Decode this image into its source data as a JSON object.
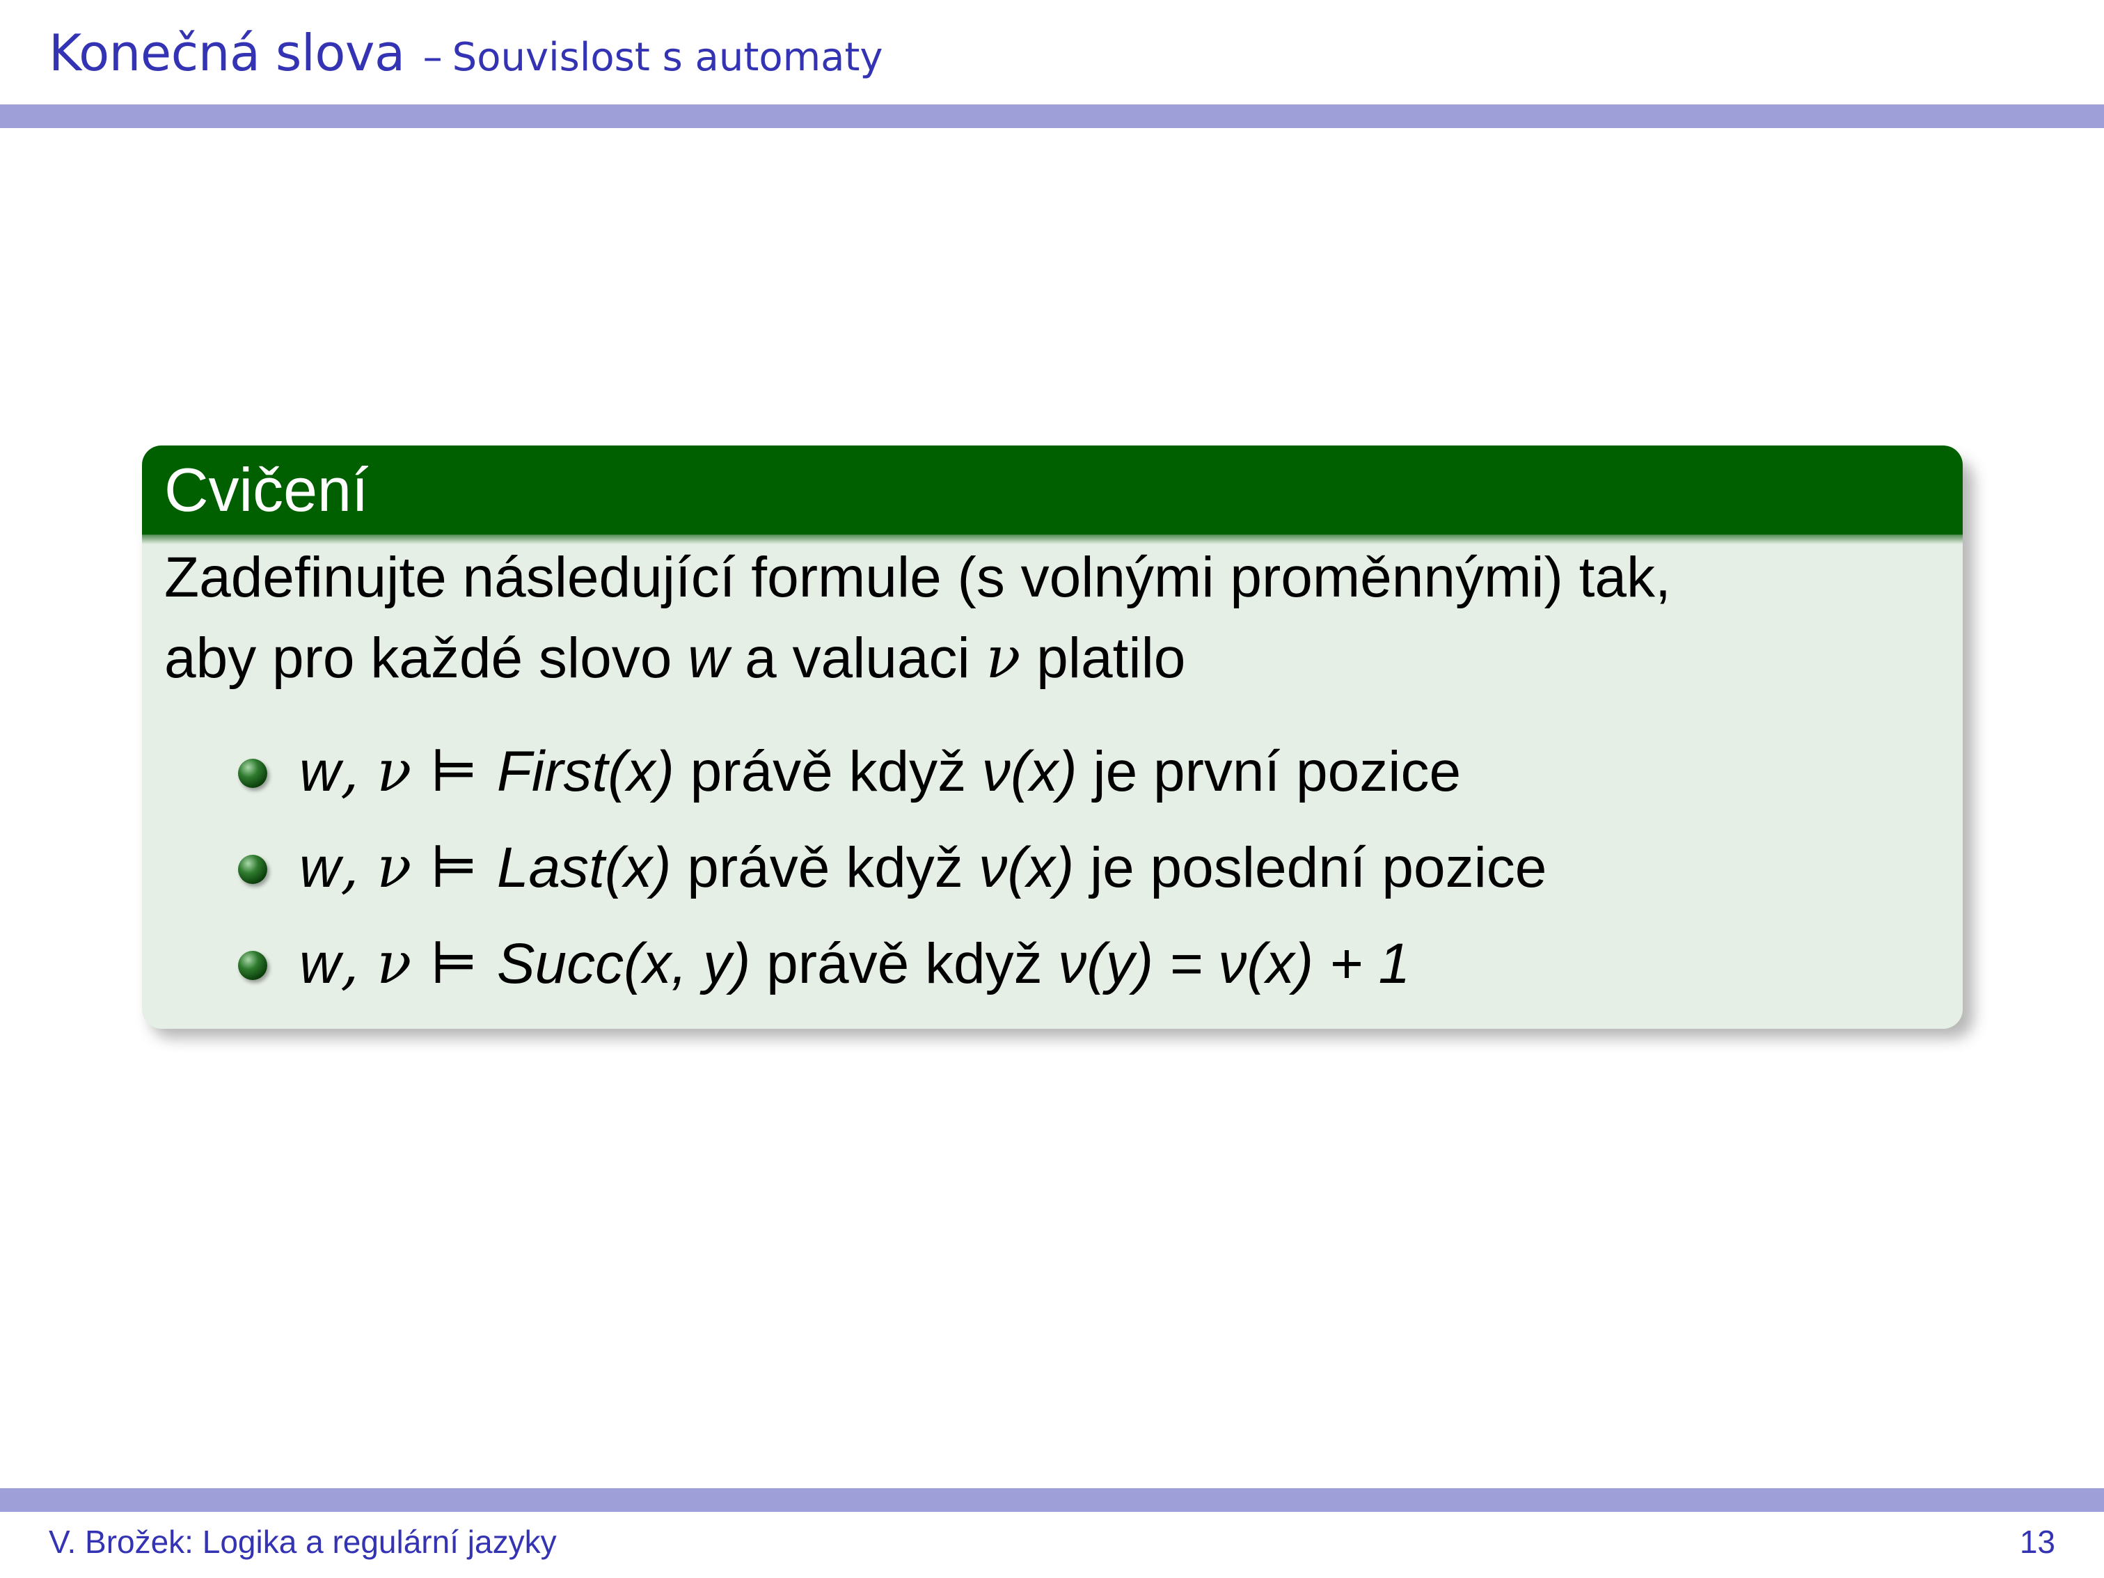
{
  "header": {
    "title": "Konečná slova",
    "separator": "–",
    "subtitle": "Souvislost s automaty"
  },
  "block": {
    "title": "Cvičení",
    "intro_line1": "Zadefinujte následující formule (s volnými proměnnými) tak,",
    "intro_line2_a": "aby pro každé slovo ",
    "intro_line2_w": "w",
    "intro_line2_b": " a valuaci ",
    "intro_line2_nu": "ν",
    "intro_line2_c": " platilo",
    "items": [
      {
        "w": "w",
        "comma_nu": ", ν",
        "models": " ⊨ ",
        "formula": "First",
        "args": "(x)",
        "text": " právě když ",
        "cond": "ν(x)",
        "rest": " je první pozice"
      },
      {
        "w": "w",
        "comma_nu": ", ν",
        "models": " ⊨ ",
        "formula": "Last",
        "args": "(x)",
        "text": " právě když ",
        "cond": "ν(x)",
        "rest": " je poslední pozice"
      },
      {
        "w": "w",
        "comma_nu": ", ν",
        "models": " ⊨ ",
        "formula": "Succ",
        "args": "(x, y)",
        "text": " právě když ",
        "cond": "ν(y) = ν(x) + 1",
        "rest": ""
      }
    ]
  },
  "footer": {
    "left": "V. Brožek: Logika a regulární jazyky",
    "page": "13"
  },
  "colors": {
    "accent": "#3333b3",
    "bar": "#9e9ed8",
    "block_title_bg": "#006000",
    "block_body_bg": "#e6efe6"
  }
}
